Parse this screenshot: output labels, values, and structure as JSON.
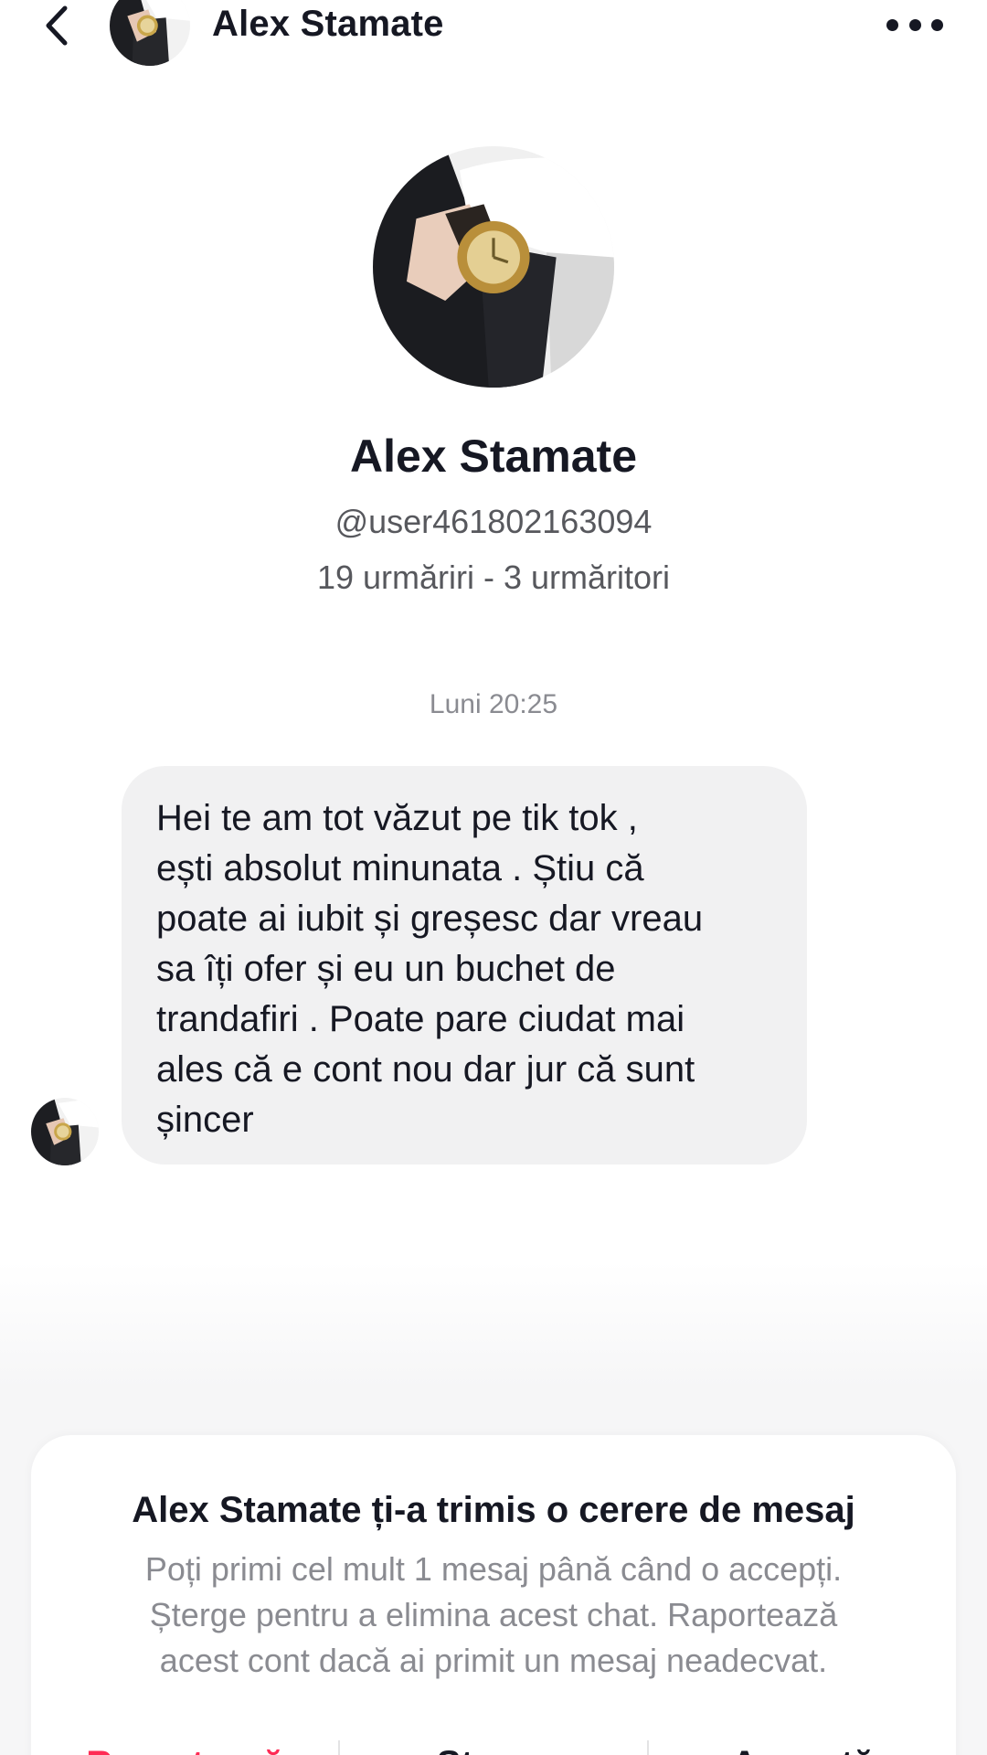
{
  "header": {
    "title": "Alex Stamate",
    "back_icon": "chevron-left-icon",
    "more_icon": "more-horizontal-icon"
  },
  "profile": {
    "name": "Alex Stamate",
    "handle": "@user461802163094",
    "stats": "19 urmăriri - 3 urmăritori"
  },
  "chat": {
    "timestamp": "Luni 20:25",
    "messages": [
      {
        "from": "Alex Stamate",
        "text": "Hei te am tot văzut pe tik tok ,\nești absolut minunata . Știu că\npoate ai iubit și greșesc dar vreau\nsa îți ofer și eu un buchet de\ntrandafiri . Poate pare ciudat mai\nales că e cont nou dar jur că sunt\nșincer"
      }
    ]
  },
  "request": {
    "title": "Alex Stamate ți-a trimis o cerere de mesaj",
    "body": "Poți primi cel mult 1 mesaj până când o accepți.\nȘterge pentru a elimina acest chat. Raportează\nacest cont dacă ai primit un mesaj neadecvat.",
    "actions": [
      "Raportează",
      "Șterge",
      "Acceptă"
    ]
  },
  "colors": {
    "text": "#161823",
    "secondary": "#57585d",
    "muted": "#8a8b91",
    "bubble": "#f1f1f2",
    "report": "#fe2c55"
  }
}
